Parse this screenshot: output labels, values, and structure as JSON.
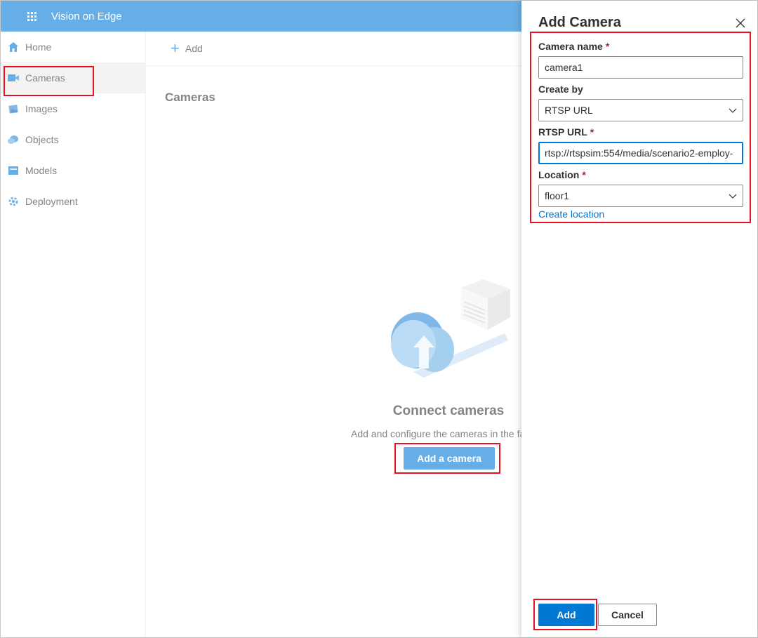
{
  "app": {
    "title": "Vision on Edge"
  },
  "sidebar": {
    "items": [
      {
        "label": "Home",
        "icon": "home-icon"
      },
      {
        "label": "Cameras",
        "icon": "camera-icon",
        "active": true
      },
      {
        "label": "Images",
        "icon": "images-icon"
      },
      {
        "label": "Objects",
        "icon": "objects-icon"
      },
      {
        "label": "Models",
        "icon": "models-icon"
      },
      {
        "label": "Deployment",
        "icon": "deployment-icon"
      }
    ]
  },
  "main": {
    "command_add": "Add",
    "page_title": "Cameras",
    "empty_title": "Connect cameras",
    "empty_description": "Add and configure the cameras in the fa",
    "add_camera_button": "Add a camera"
  },
  "panel": {
    "title": "Add Camera",
    "required_mark": "*",
    "camera_name": {
      "label": "Camera name",
      "value": "camera1"
    },
    "create_by": {
      "label": "Create by",
      "value": "RTSP URL"
    },
    "rtsp_url": {
      "label": "RTSP URL",
      "value": "rtsp://rtspsim:554/media/scenario2-employ-"
    },
    "location": {
      "label": "Location",
      "value": "floor1"
    },
    "create_location_link": "Create location",
    "add_button": "Add",
    "cancel_button": "Cancel"
  },
  "colors": {
    "brand": "#0078d4",
    "highlight": "#e81123",
    "required": "#a4262c"
  }
}
